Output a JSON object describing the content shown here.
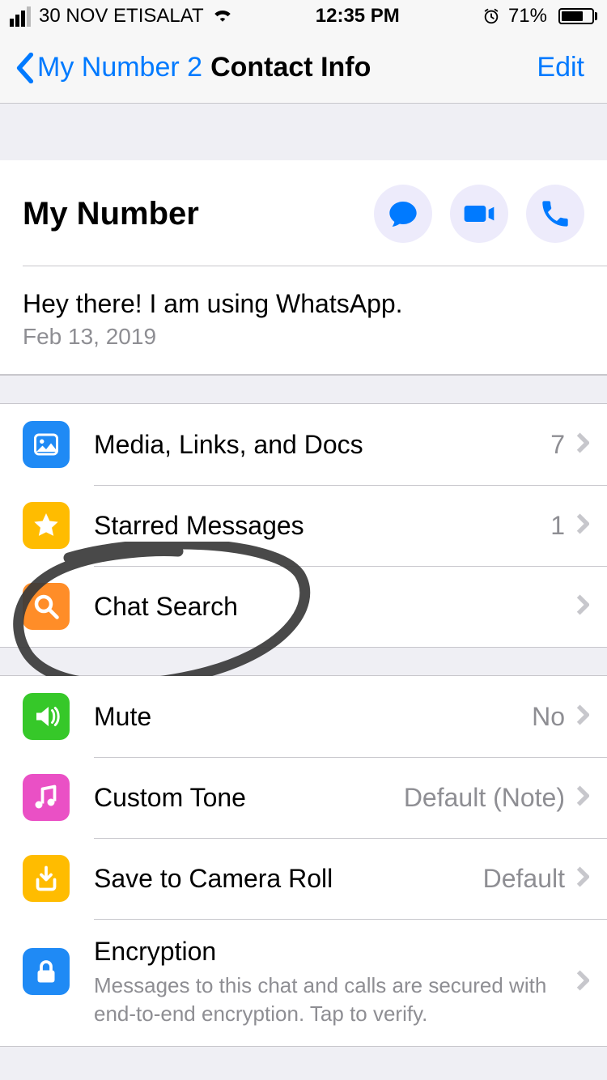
{
  "statusbar": {
    "carrier": "30 NOV ETISALAT",
    "time": "12:35 PM",
    "battery_pct": "71%"
  },
  "nav": {
    "back_label": "My Number 2",
    "title": "Contact Info",
    "edit": "Edit"
  },
  "profile": {
    "name": "My Number",
    "status": "Hey there! I am using WhatsApp.",
    "date": "Feb 13, 2019"
  },
  "group1": {
    "media": {
      "label": "Media, Links, and Docs",
      "count": "7"
    },
    "starred": {
      "label": "Starred Messages",
      "count": "1"
    },
    "search": {
      "label": "Chat Search"
    }
  },
  "group2": {
    "mute": {
      "label": "Mute",
      "value": "No"
    },
    "tone": {
      "label": "Custom Tone",
      "value": "Default (Note)"
    },
    "save": {
      "label": "Save to Camera Roll",
      "value": "Default"
    },
    "enc": {
      "label": "Encryption",
      "sub": "Messages to this chat and calls are secured with end-to-end encryption. Tap to verify."
    }
  },
  "colors": {
    "blue": "#1f8af5",
    "yellow": "#ffbc00",
    "orange": "#ff8d28",
    "green": "#36c829",
    "pink": "#ea50c5",
    "bblue": "#1f8af5"
  }
}
